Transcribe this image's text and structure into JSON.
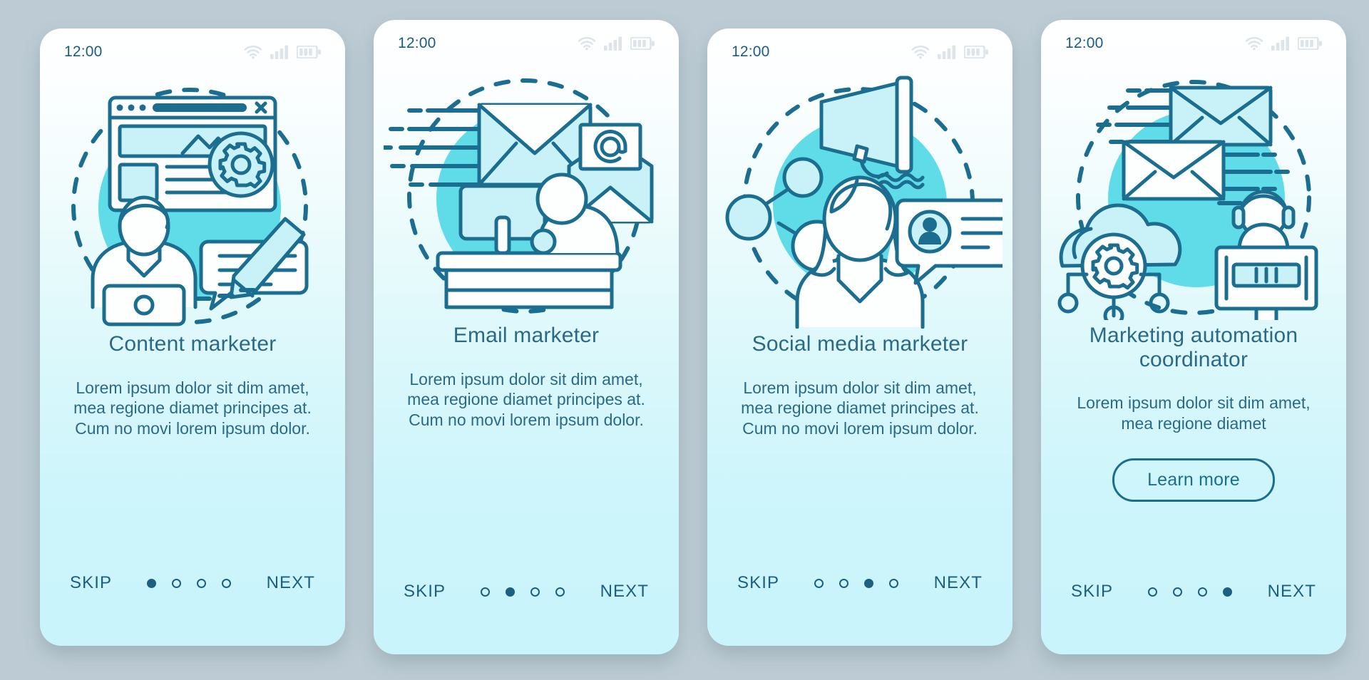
{
  "meta": {
    "background_color": "#bdccd4",
    "accent_color": "#1c6e91",
    "title_color": "#2b6a86",
    "circle_color": "#5fdce8",
    "card_gradient_top": "#ffffff",
    "card_gradient_bottom": "#c9f4fb"
  },
  "statusbar": {
    "time": "12:00",
    "icons": [
      "wifi-icon",
      "signal-icon",
      "battery-icon"
    ]
  },
  "nav": {
    "skip_label": "SKIP",
    "next_label": "NEXT",
    "dot_count": 4
  },
  "screens": [
    {
      "id": "content-marketer",
      "title": "Content marketer",
      "body": "Lorem ipsum dolor sit dim amet, mea regione diamet principes at. Cum no movi lorem ipsum dolor.",
      "active_dot": 1,
      "illustration": "browser-window-gear-person-laptop-speech-pencil",
      "has_learn_more": false,
      "learn_more_label": null
    },
    {
      "id": "email-marketer",
      "title": "Email marketer",
      "body": "Lorem ipsum dolor sit dim amet, mea regione diamet principes at. Cum no movi lorem ipsum dolor.",
      "active_dot": 2,
      "illustration": "envelopes-at-sign-person-desk-monitor",
      "has_learn_more": false,
      "learn_more_label": null
    },
    {
      "id": "social-media-marketer",
      "title": "Social media marketer",
      "body": "Lorem ipsum dolor sit dim amet, mea regione diamet principes at. Cum no movi lorem ipsum dolor.",
      "active_dot": 3,
      "illustration": "megaphone-network-woman-profile-bubble",
      "has_learn_more": false,
      "learn_more_label": null
    },
    {
      "id": "marketing-automation-coordinator",
      "title": "Marketing automation coordinator",
      "body": "Lorem ipsum dolor sit dim amet, mea regione diamet",
      "active_dot": 4,
      "illustration": "envelopes-cloud-gear-headset-agent-monitor",
      "has_learn_more": true,
      "learn_more_label": "Learn more"
    }
  ]
}
